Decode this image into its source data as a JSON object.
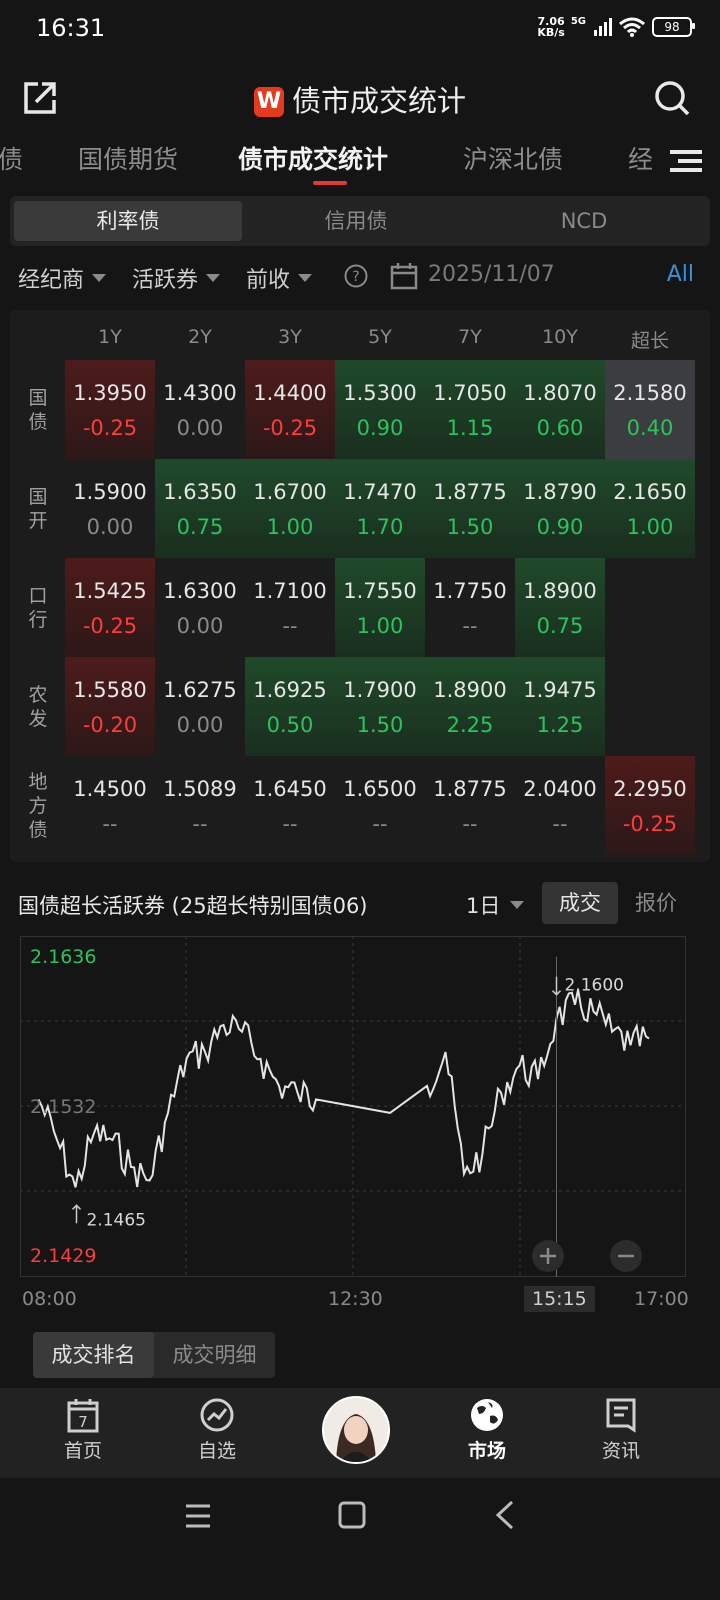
{
  "status": {
    "time": "16:31",
    "speed_value": "7.06",
    "speed_unit": "KB/s",
    "network": "5G",
    "battery": "98"
  },
  "header": {
    "logo": "W",
    "title": "债市成交统计"
  },
  "tabs": [
    {
      "label": "债"
    },
    {
      "label": "国债期货"
    },
    {
      "label": "债市成交统计"
    },
    {
      "label": "沪深北债"
    },
    {
      "label": "经"
    }
  ],
  "segment": [
    "利率债",
    "信用债",
    "NCD"
  ],
  "filters": {
    "broker": "经纪商",
    "active_bond": "活跃券",
    "price": "前收",
    "date": "2025/11/07",
    "all": "All"
  },
  "grid": {
    "columns": [
      "1Y",
      "2Y",
      "3Y",
      "5Y",
      "7Y",
      "10Y",
      "超长"
    ],
    "rows": [
      {
        "label": "国\n债",
        "cells": [
          {
            "v": "1.3950",
            "c": "-0.25"
          },
          {
            "v": "1.4300",
            "c": "0.00"
          },
          {
            "v": "1.4400",
            "c": "-0.25"
          },
          {
            "v": "1.5300",
            "c": "0.90"
          },
          {
            "v": "1.7050",
            "c": "1.15"
          },
          {
            "v": "1.8070",
            "c": "0.60"
          },
          {
            "v": "2.1580",
            "c": "0.40"
          }
        ]
      },
      {
        "label": "国\n开",
        "cells": [
          {
            "v": "1.5900",
            "c": "0.00"
          },
          {
            "v": "1.6350",
            "c": "0.75"
          },
          {
            "v": "1.6700",
            "c": "1.00"
          },
          {
            "v": "1.7470",
            "c": "1.70"
          },
          {
            "v": "1.8775",
            "c": "1.50"
          },
          {
            "v": "1.8790",
            "c": "0.90"
          },
          {
            "v": "2.1650",
            "c": "1.00"
          }
        ]
      },
      {
        "label": "口\n行",
        "cells": [
          {
            "v": "1.5425",
            "c": "-0.25"
          },
          {
            "v": "1.6300",
            "c": "0.00"
          },
          {
            "v": "1.7100",
            "c": "--"
          },
          {
            "v": "1.7550",
            "c": "1.00"
          },
          {
            "v": "1.7750",
            "c": "--"
          },
          {
            "v": "1.8900",
            "c": "0.75"
          },
          {
            "v": "",
            "c": ""
          }
        ]
      },
      {
        "label": "农\n发",
        "cells": [
          {
            "v": "1.5580",
            "c": "-0.20"
          },
          {
            "v": "1.6275",
            "c": "0.00"
          },
          {
            "v": "1.6925",
            "c": "0.50"
          },
          {
            "v": "1.7900",
            "c": "1.50"
          },
          {
            "v": "1.8900",
            "c": "2.25"
          },
          {
            "v": "1.9475",
            "c": "1.25"
          },
          {
            "v": "",
            "c": ""
          }
        ]
      },
      {
        "label": "地\n方\n债",
        "cells": [
          {
            "v": "1.4500",
            "c": "--"
          },
          {
            "v": "1.5089",
            "c": "--"
          },
          {
            "v": "1.6450",
            "c": "--"
          },
          {
            "v": "1.6500",
            "c": "--"
          },
          {
            "v": "1.8775",
            "c": "--"
          },
          {
            "v": "2.0400",
            "c": "--"
          },
          {
            "v": "2.2950",
            "c": "-0.25"
          }
        ]
      }
    ]
  },
  "chart_section": {
    "title": "国债超长活跃券 (25超长特别国债06)",
    "period": "1日",
    "toggle": [
      "成交",
      "报价"
    ]
  },
  "chart_data": {
    "type": "line",
    "y_max_label": "2.1636",
    "y_mid_label": "2.1532",
    "y_min_label": "2.1429",
    "ylim": [
      2.1429,
      2.1636
    ],
    "high_marker": "2.1600",
    "low_marker": "2.1465",
    "x_ticks": [
      "08:00",
      "12:30",
      "15:15",
      "17:00"
    ],
    "x": [
      "08:15",
      "08:30",
      "08:45",
      "09:00",
      "09:15",
      "09:30",
      "09:45",
      "10:00",
      "10:15",
      "10:30",
      "10:45",
      "11:00",
      "11:15",
      "11:30",
      "11:45",
      "12:00",
      "12:30",
      "13:00",
      "13:30",
      "13:45",
      "14:00",
      "14:15",
      "14:30",
      "14:45",
      "15:00",
      "15:15",
      "15:30",
      "15:45",
      "16:00",
      "16:15",
      "16:30"
    ],
    "values": [
      2.153,
      2.15,
      2.1465,
      2.1505,
      2.15,
      2.148,
      2.147,
      2.152,
      2.156,
      2.1565,
      2.1585,
      2.158,
      2.156,
      2.154,
      2.1535,
      2.153,
      2.1525,
      2.152,
      2.154,
      2.1565,
      2.1475,
      2.149,
      2.1535,
      2.1555,
      2.1545,
      2.159,
      2.16,
      2.1595,
      2.158,
      2.157,
      2.1575
    ]
  },
  "sub_tabs": [
    "成交排名",
    "成交明细"
  ],
  "nav": [
    {
      "label": "首页",
      "icon": "calendar-icon"
    },
    {
      "label": "自选",
      "icon": "trend-icon"
    },
    {
      "label": "",
      "icon": "avatar"
    },
    {
      "label": "市场",
      "icon": "globe-icon"
    },
    {
      "label": "资讯",
      "icon": "news-icon"
    }
  ],
  "calendar_day": "7"
}
